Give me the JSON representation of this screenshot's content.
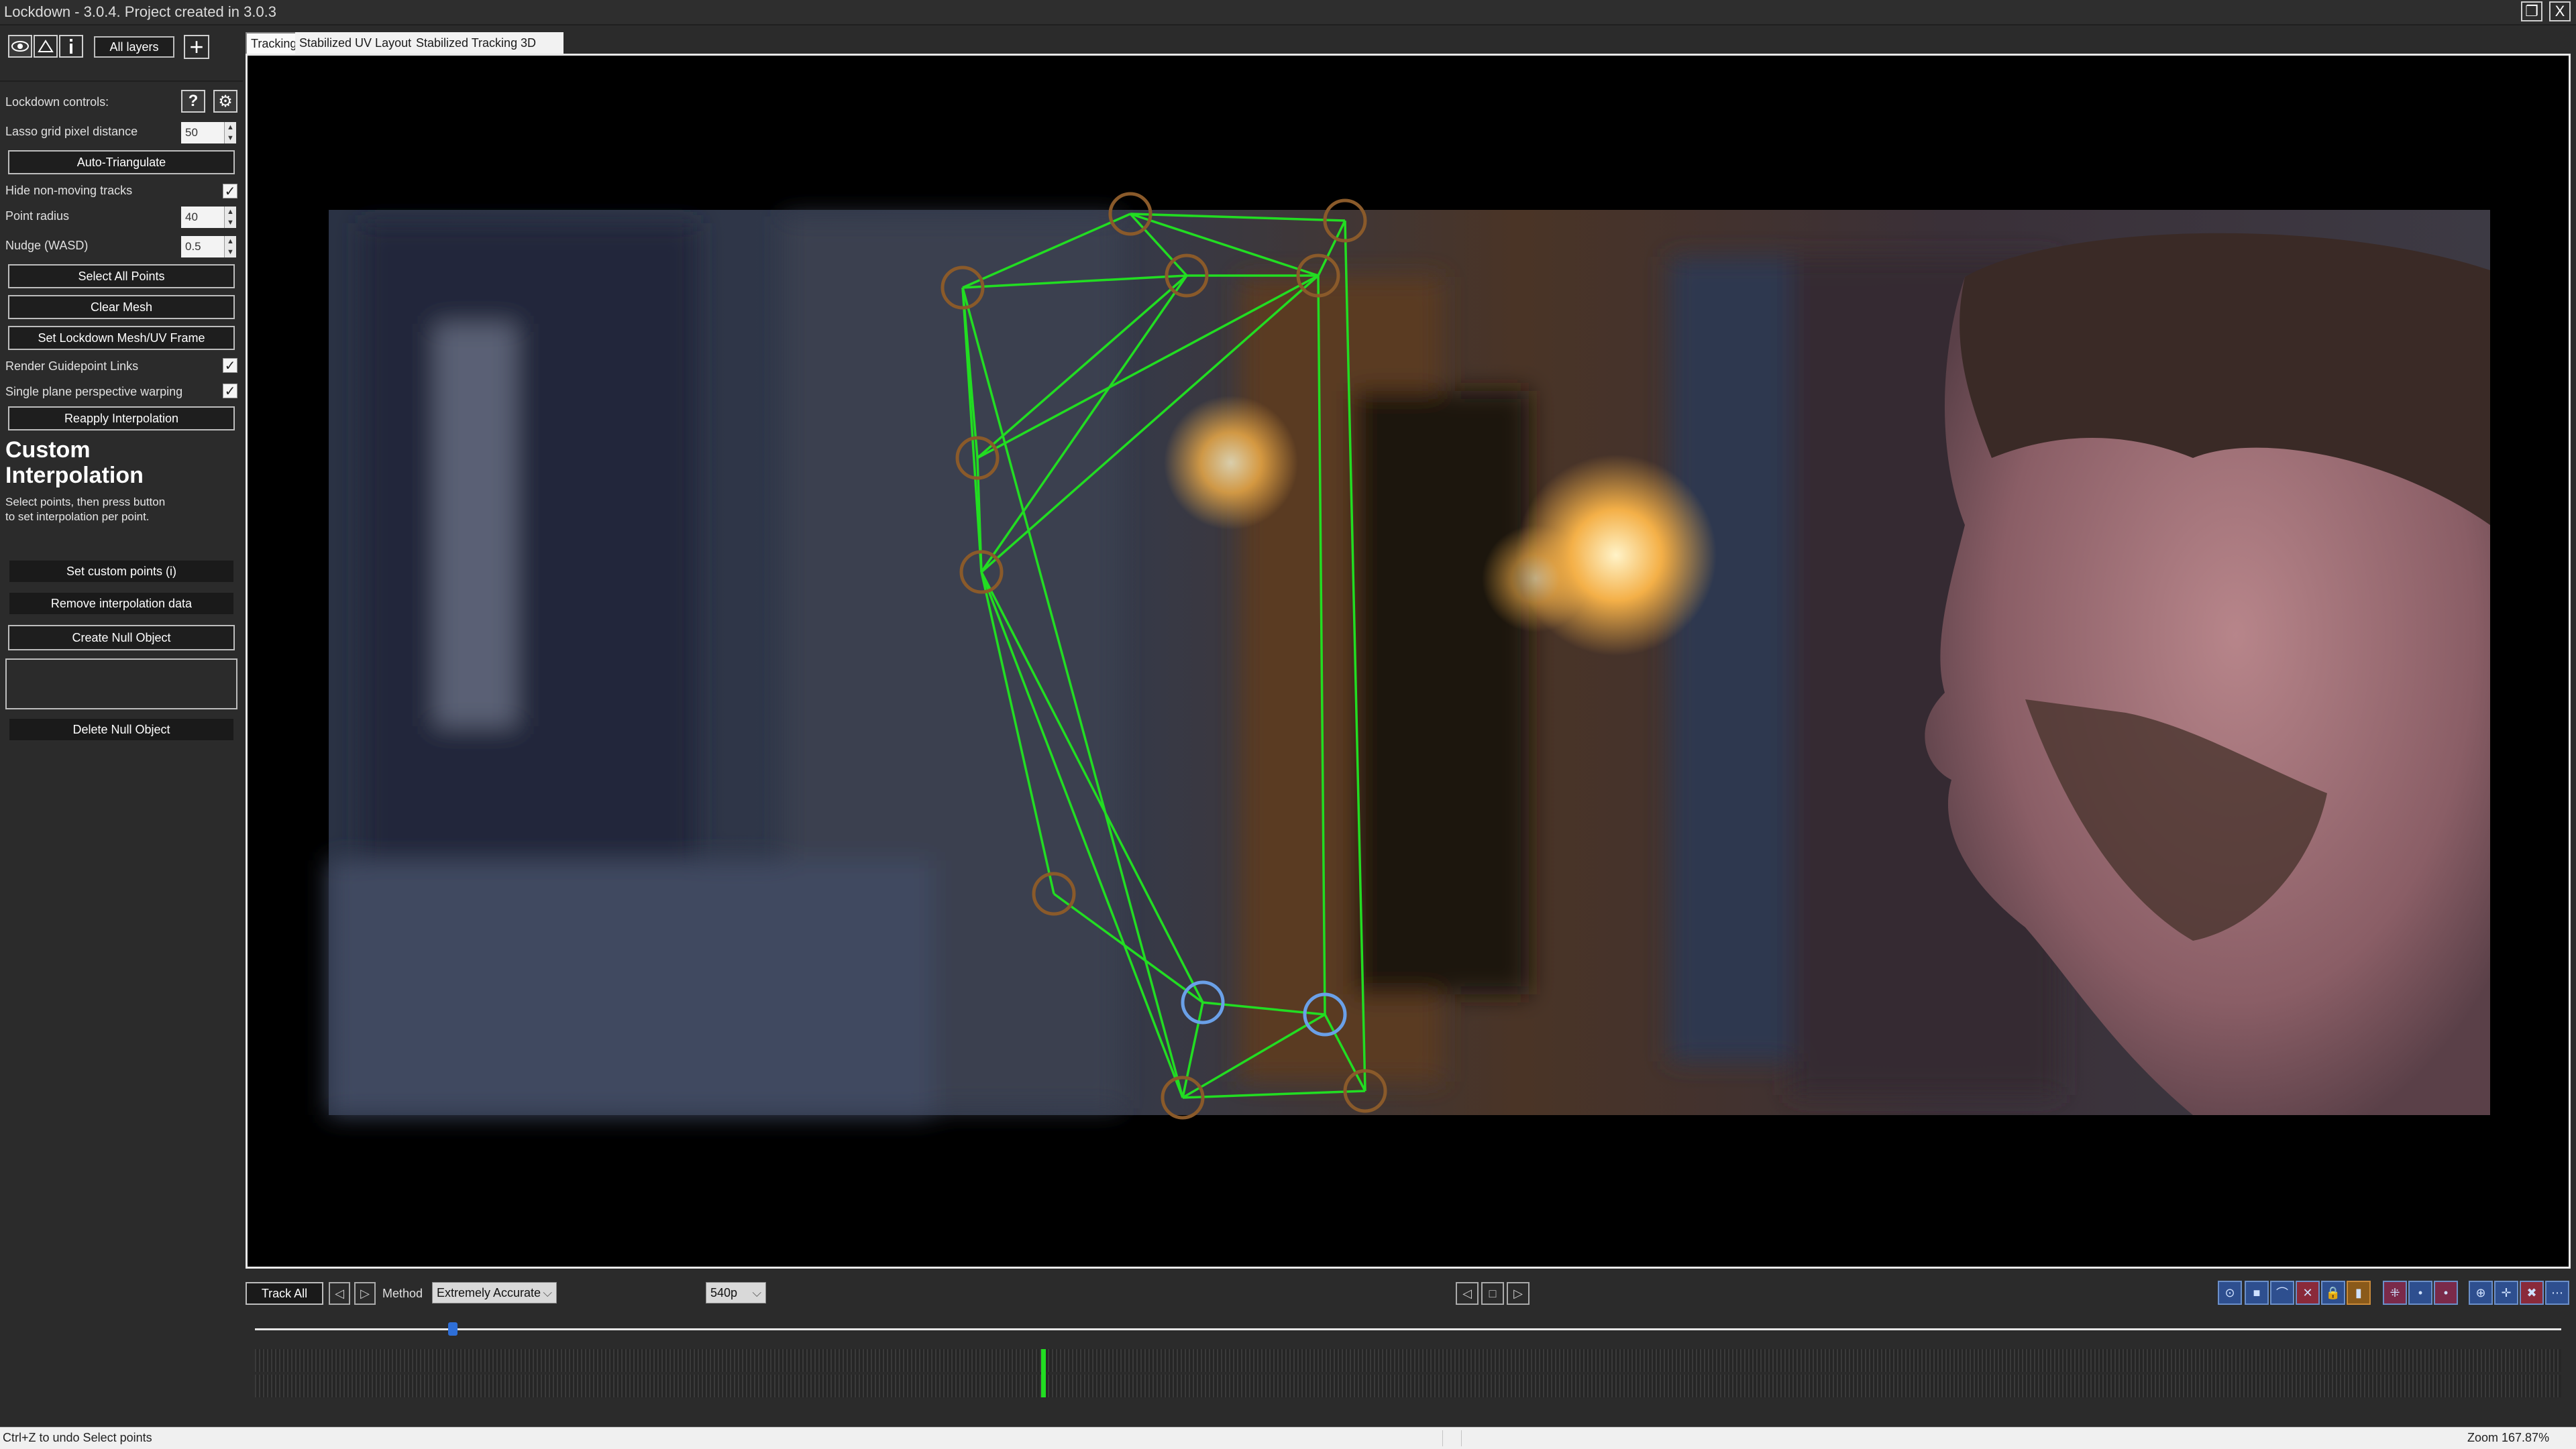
{
  "window": {
    "title": "Lockdown - 3.0.4. Project created in 3.0.3",
    "restore_glyph": "❐",
    "close_glyph": "X"
  },
  "left_panel": {
    "layers_button": "All layers",
    "add_glyph": "+",
    "lockdown_controls_label": "Lockdown controls:",
    "help_glyph": "?",
    "settings_glyph": "⚙",
    "lasso_label": "Lasso grid pixel distance",
    "lasso_value": "50",
    "auto_triangulate": "Auto-Triangulate",
    "hide_nonmoving_label": "Hide non-moving tracks",
    "hide_nonmoving_checked": true,
    "point_radius_label": "Point radius",
    "point_radius_value": "40",
    "nudge_label": "Nudge (WASD)",
    "nudge_value": "0.5",
    "select_all_points": "Select All Points",
    "clear_mesh": "Clear Mesh",
    "set_lockdown_mesh": "Set Lockdown Mesh/UV Frame",
    "render_links_label": "Render Guidepoint Links",
    "render_links_checked": true,
    "single_plane_label": "Single plane perspective warping",
    "single_plane_checked": true,
    "reapply_interpolation": "Reapply Interpolation",
    "custom_heading_line1": "Custom",
    "custom_heading_line2": "Interpolation",
    "custom_desc_line1": "Select points, then press button",
    "custom_desc_line2": "to set interpolation per point.",
    "set_custom_points": "Set custom points (i)",
    "remove_interpolation": "Remove interpolation data",
    "create_null": "Create Null Object",
    "delete_null": "Delete Null Object",
    "check_glyph": "✓"
  },
  "tabs": [
    "Tracking",
    "Stabilized UV Layout",
    "Stabilized Tracking",
    "3D"
  ],
  "bottom_bar": {
    "track_all": "Track All",
    "method_label": "Method",
    "method_value": "Extremely Accurate",
    "resolution_value": "540p",
    "chevron": "⌵"
  },
  "status": {
    "left": "Ctrl+Z to undo Select points",
    "zoom": "Zoom 167.87%"
  },
  "colors": {
    "mesh_line": "#22dd22",
    "point_orange": "#8a5a2a",
    "point_selected": "#6aa0e8",
    "timeline_marker": "#22dd22",
    "accent_blue": "#2e6fd8"
  }
}
